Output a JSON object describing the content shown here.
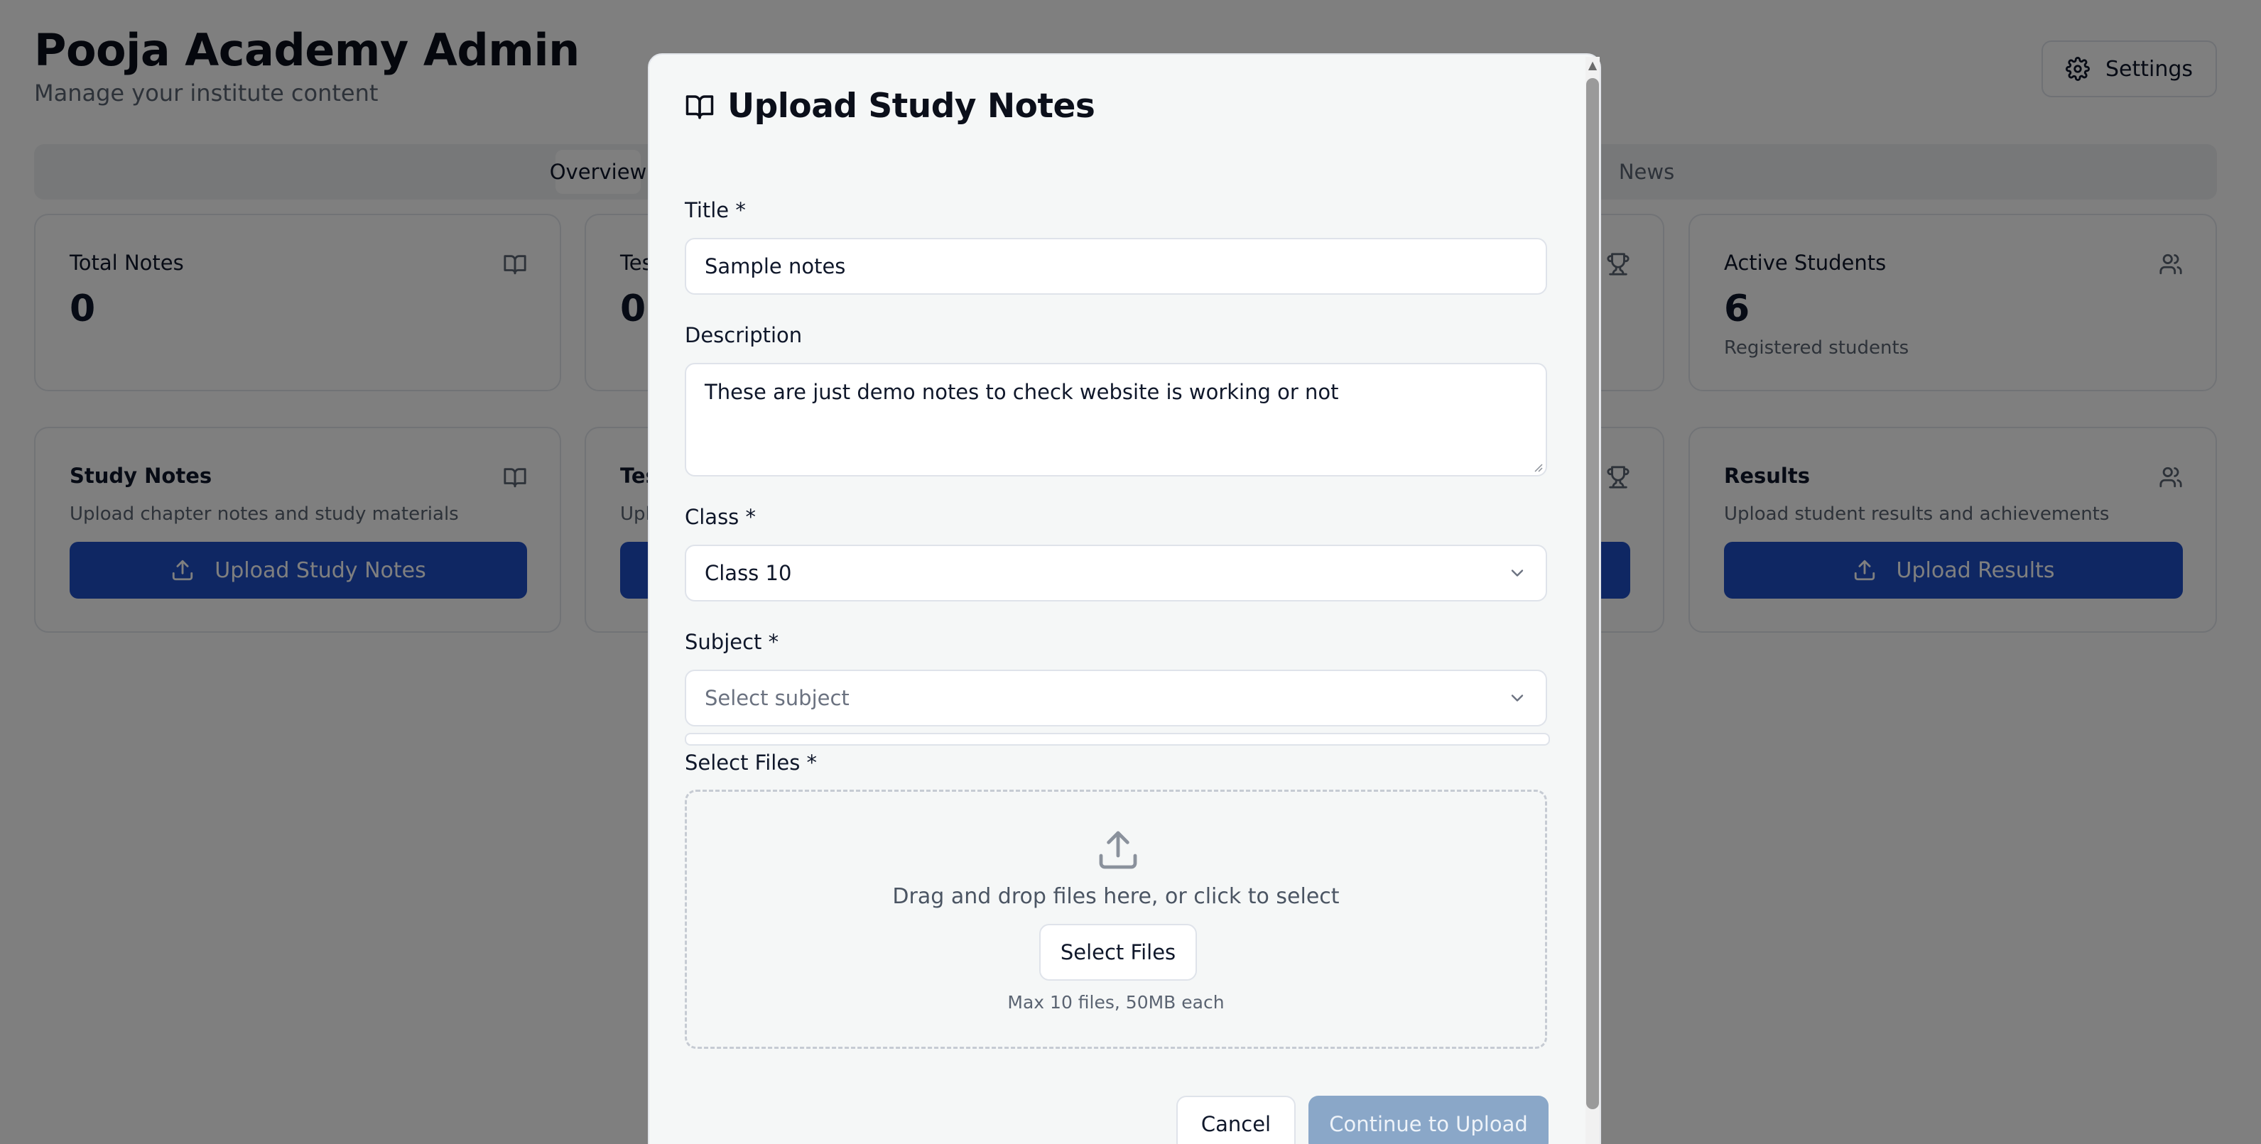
{
  "app": {
    "title": "Pooja Academy Admin",
    "subtitle": "Manage your institute content",
    "settings_label": "Settings"
  },
  "tabs": [
    {
      "label": "Overview",
      "active": true
    },
    {
      "label": "News",
      "active": false
    }
  ],
  "stats": [
    {
      "label": "Total Notes",
      "value": "0",
      "icon": "book-open-icon"
    },
    {
      "label": "Tes",
      "value": "0",
      "icon": "none"
    },
    {
      "label": "",
      "value": "",
      "icon": "trophy-icon"
    },
    {
      "label": "Active Students",
      "value": "6",
      "sub": "Registered students",
      "icon": "users-icon"
    }
  ],
  "sections": [
    {
      "title": "Study Notes",
      "desc": "Upload chapter notes and study materials",
      "button": "Upload Study Notes",
      "icon": "book-open-icon"
    },
    {
      "title": "Tes",
      "desc": "Upl",
      "button": "",
      "icon": "none"
    },
    {
      "title": "",
      "desc": "",
      "button": "",
      "icon": "trophy-icon"
    },
    {
      "title": "Results",
      "desc": "Upload student results and achievements",
      "button": "Upload Results",
      "icon": "users-icon"
    }
  ],
  "modal": {
    "title": "Upload Study Notes",
    "title_label": "Title *",
    "title_value": "Sample notes",
    "description_label": "Description",
    "description_value": "These are just demo notes to check website is working or not",
    "class_label": "Class *",
    "class_value": "Class 10",
    "subject_label": "Subject *",
    "subject_placeholder": "Select subject",
    "files_label": "Select Files *",
    "dropzone_text": "Drag and drop files here, or click to select",
    "select_files_button": "Select Files",
    "dropzone_note": "Max 10 files, 50MB each",
    "cancel_button": "Cancel",
    "continue_button": "Continue to Upload"
  },
  "colors": {
    "primary": "#1e4fc7",
    "disabled_button": "#8aa7c8",
    "overlay": "#000000"
  }
}
